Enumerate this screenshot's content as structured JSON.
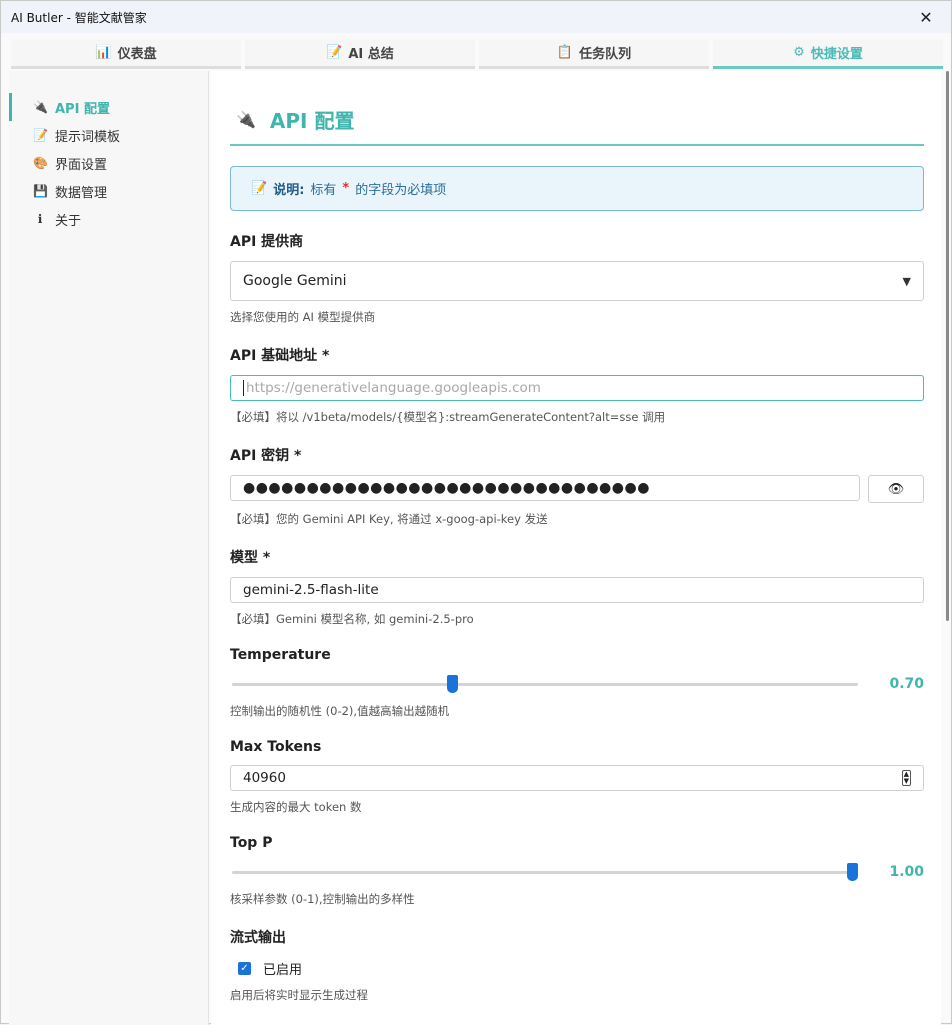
{
  "window": {
    "title": "AI Butler - 智能文献管家",
    "close_glyph": "✕"
  },
  "tabs": [
    {
      "label": "仪表盘",
      "icon": "bar-chart-icon",
      "glyph": "📊",
      "active": false
    },
    {
      "label": "AI 总结",
      "icon": "memo-icon",
      "glyph": "📝",
      "active": false
    },
    {
      "label": "任务队列",
      "icon": "clipboard-icon",
      "glyph": "📋",
      "active": false
    },
    {
      "label": "快捷设置",
      "icon": "gear-icon",
      "glyph": "⚙",
      "active": true
    }
  ],
  "sidebar": {
    "items": [
      {
        "label": "API 配置",
        "icon": "plug-icon",
        "glyph": "🔌",
        "active": true
      },
      {
        "label": "提示词模板",
        "icon": "memo-icon",
        "glyph": "📝",
        "active": false
      },
      {
        "label": "界面设置",
        "icon": "palette-icon",
        "glyph": "🎨",
        "active": false
      },
      {
        "label": "数据管理",
        "icon": "floppy-disk-icon",
        "glyph": "💾",
        "active": false
      },
      {
        "label": "关于",
        "icon": "info-icon",
        "glyph": "ℹ",
        "active": false
      }
    ]
  },
  "main": {
    "title": "API 配置",
    "title_icon": "🔌",
    "note": {
      "icon": "📝",
      "bold": "说明:",
      "pre": "标有",
      "star": "*",
      "post": "的字段为必填项"
    },
    "provider": {
      "label": "API 提供商",
      "value": "Google Gemini",
      "arrow": "▼",
      "hint": "选择您使用的 AI 模型提供商"
    },
    "base_url": {
      "label": "API 基础地址 *",
      "placeholder": "https://generativelanguage.googleapis.com",
      "hint": "【必填】将以 /v1beta/models/{模型名}:streamGenerateContent?alt=sse 调用"
    },
    "api_key": {
      "label": "API 密钥 *",
      "value": "●●●●●●●●●●●●●●●●●●●●●●●●●●●●●●●●",
      "toggle_icon": "👁",
      "hint": "【必填】您的 Gemini API Key, 将通过 x-goog-api-key 发送"
    },
    "model": {
      "label": "模型 *",
      "value": "gemini-2.5-flash-lite",
      "hint": "【必填】Gemini 模型名称, 如 gemini-2.5-pro"
    },
    "temperature": {
      "label": "Temperature",
      "value": 0.7,
      "display": "0.70",
      "min": 0,
      "max": 2,
      "hint": "控制输出的随机性 (0-2),值越高输出越随机"
    },
    "max_tokens": {
      "label": "Max Tokens",
      "value": "40960",
      "hint": "生成内容的最大 token 数"
    },
    "top_p": {
      "label": "Top P",
      "value": 1.0,
      "display": "1.00",
      "min": 0,
      "max": 1,
      "hint": "核采样参数 (0-1),控制输出的多样性"
    },
    "stream": {
      "label": "流式输出",
      "checked": true,
      "check_glyph": "✓",
      "check_label": "已启用",
      "hint": "启用后将实时显示生成过程"
    }
  }
}
